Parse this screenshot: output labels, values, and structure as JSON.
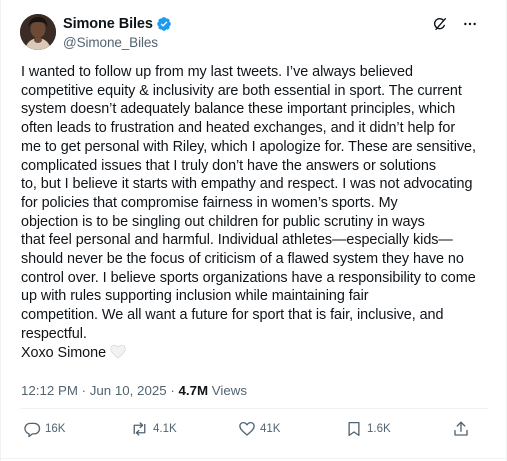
{
  "author": {
    "display_name": "Simone Biles",
    "handle": "@Simone_Biles",
    "verified": true
  },
  "header_icons": [
    "grok-icon",
    "more-icon"
  ],
  "tweet": {
    "lines": [
      "I wanted to follow up from my last tweets. I’ve always believed",
      "competitive equity & inclusivity are both essential in sport. The current",
      "system doesn’t adequately balance these important principles, which",
      "often leads to frustration and heated exchanges, and it didn’t help for",
      "me to get personal with Riley, which I apologize for. These are sensitive,",
      "complicated issues that I truly don’t have the answers or solutions",
      "to, but I believe it starts with empathy and respect. I was not advocating",
      "for policies that compromise fairness in women’s sports. My",
      "objection is to be singling out children for public scrutiny in ways",
      "that feel personal and harmful. Individual athletes—especially kids—",
      "should never be the focus of criticism of a flawed system they have no",
      "control over. I believe sports organizations have a responsibility to come",
      "up with rules supporting inclusion while maintaining fair",
      "competition. We all want a future for sport that is fair, inclusive, and",
      "respectful."
    ],
    "signoff": "Xoxo Simone",
    "signoff_emoji": "white-heart-emoji"
  },
  "meta": {
    "time": "12:12 PM",
    "separator": " · ",
    "date": "Jun 10, 2025",
    "separator2": " · ",
    "views_count": "4.7M",
    "views_label": " Views"
  },
  "actions": {
    "replies": "16K",
    "reposts": "4.1K",
    "likes": "41K",
    "bookmarks": "1.6K"
  },
  "colors": {
    "text": "#0f1419",
    "secondary": "#536471",
    "verified": "#1d9bf0",
    "border": "#eff3f4"
  }
}
